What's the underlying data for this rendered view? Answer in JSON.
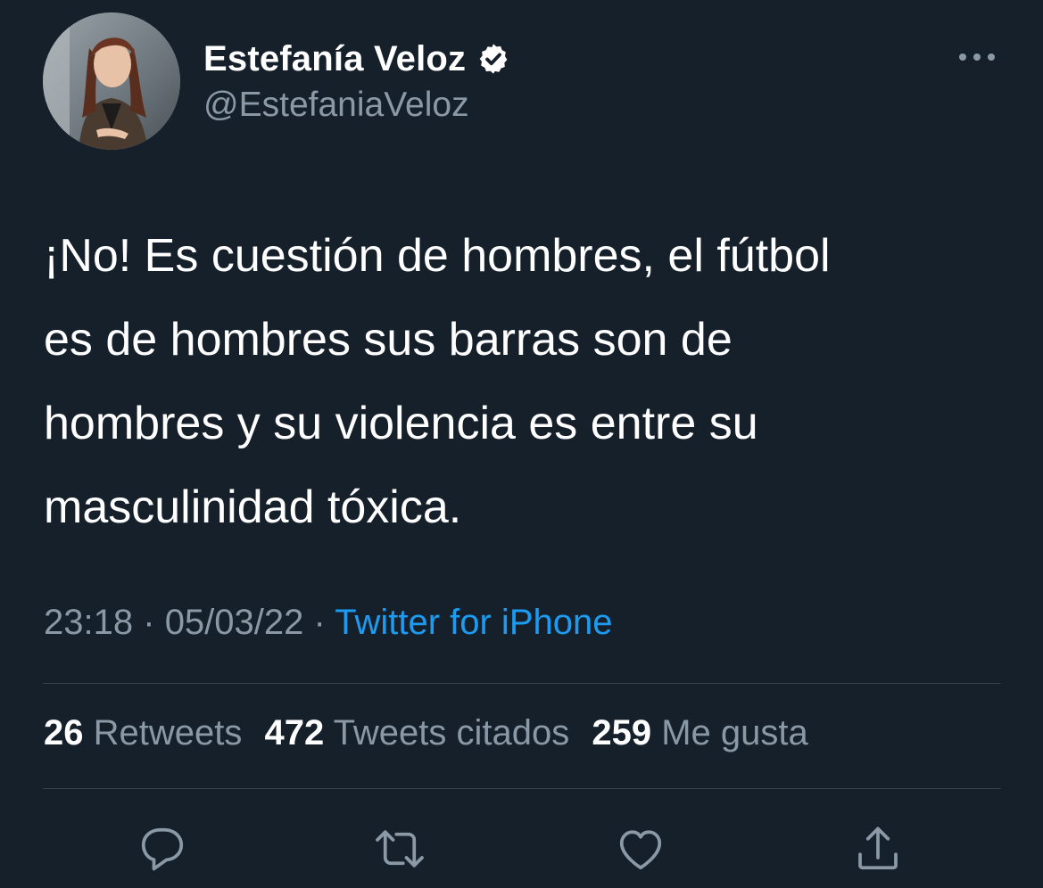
{
  "header": {
    "display_name": "Estefanía Veloz",
    "handle": "@EstefaniaVeloz",
    "verified_icon": "verified-badge-icon",
    "more_icon": "more-horizontal-icon"
  },
  "tweet": {
    "lines": [
      "¡No! Es cuestión de hombres, el fútbol",
      "es de hombres sus barras son de",
      "hombres y su violencia es entre su",
      "masculinidad tóxica."
    ],
    "time": "23:18",
    "separator": "·",
    "date": "05/03/22",
    "source": "Twitter for iPhone"
  },
  "stats": {
    "retweets_count": "26",
    "retweets_label": "Retweets",
    "quotes_count": "472",
    "quotes_label": "Tweets citados",
    "likes_count": "259",
    "likes_label": "Me gusta"
  },
  "actions": {
    "reply_icon": "reply-icon",
    "retweet_icon": "retweet-icon",
    "like_icon": "heart-icon",
    "share_icon": "share-icon"
  },
  "colors": {
    "background": "#15202b",
    "primary_text": "#ffffff",
    "secondary_text": "#8b98a5",
    "link": "#1d9bf0",
    "divider": "#38444d"
  }
}
